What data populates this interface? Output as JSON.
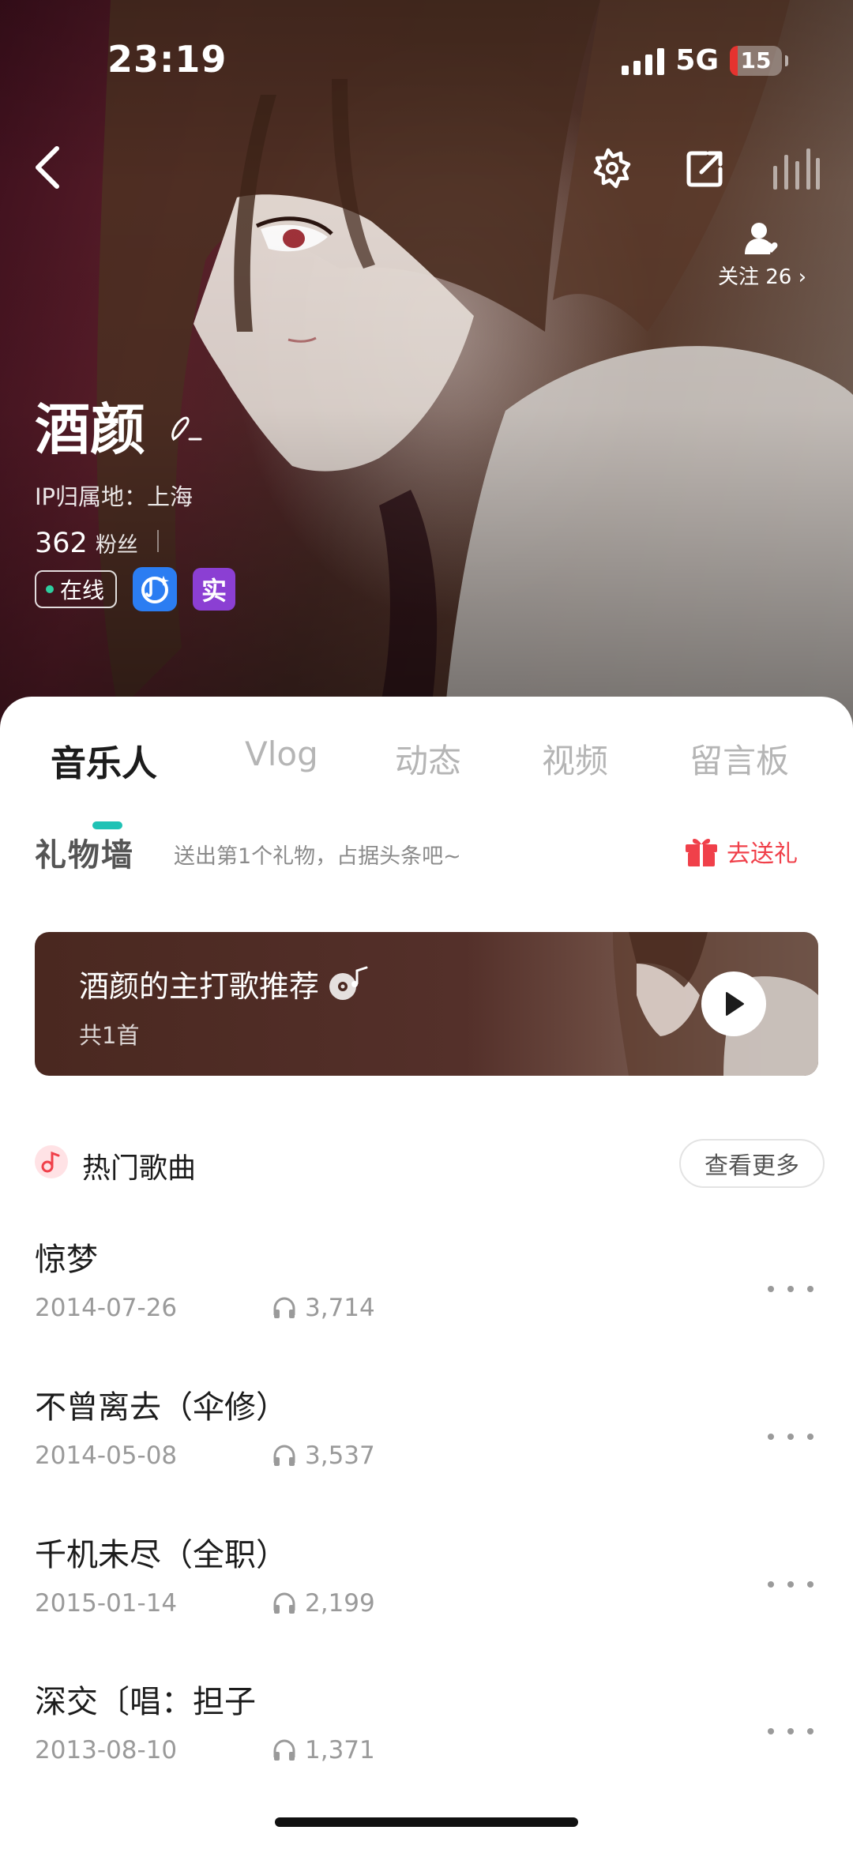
{
  "status_bar": {
    "time": "23:19",
    "network": "5G",
    "battery": "15",
    "battery_level_percent": 15
  },
  "header": {
    "follow_text": "关注 26 ›",
    "icons": [
      "back-icon",
      "badge-icon",
      "share-icon",
      "equalizer-icon"
    ]
  },
  "profile": {
    "name": "酒颜",
    "ip_location": "IP归属地：上海",
    "fans_count": "362",
    "fans_label": "粉丝",
    "online_label": "在线",
    "real_badge_label": "实"
  },
  "tabs": [
    {
      "label": "音乐人",
      "active": true
    },
    {
      "label": "Vlog",
      "active": false
    },
    {
      "label": "动态",
      "active": false
    },
    {
      "label": "视频",
      "active": false
    },
    {
      "label": "留言板",
      "active": false
    }
  ],
  "gift_wall": {
    "title": "礼物墙",
    "hint": "送出第1个礼物，占据头条吧~",
    "send_label": "去送礼"
  },
  "featured_playlist": {
    "title": "酒颜的主打歌推荐",
    "count": "共1首"
  },
  "hot_songs": {
    "title": "热门歌曲",
    "more_label": "查看更多",
    "songs": [
      {
        "title": "惊梦",
        "date": "2014-07-26",
        "plays": "3,714"
      },
      {
        "title": "不曾离去（伞修）",
        "date": "2014-05-08",
        "plays": "3,537"
      },
      {
        "title": "千机未尽（全职）",
        "date": "2015-01-14",
        "plays": "2,199"
      },
      {
        "title": "深交〔唱：担子",
        "date": "2013-08-10",
        "plays": "1,371"
      }
    ]
  },
  "colors": {
    "accent_teal": "#1fc2b5",
    "gift_red": "#f0404a",
    "musician_badge_blue": "#2b7df2",
    "real_badge_purple": "#8b3fd3",
    "online_green": "#2ecfa0"
  }
}
